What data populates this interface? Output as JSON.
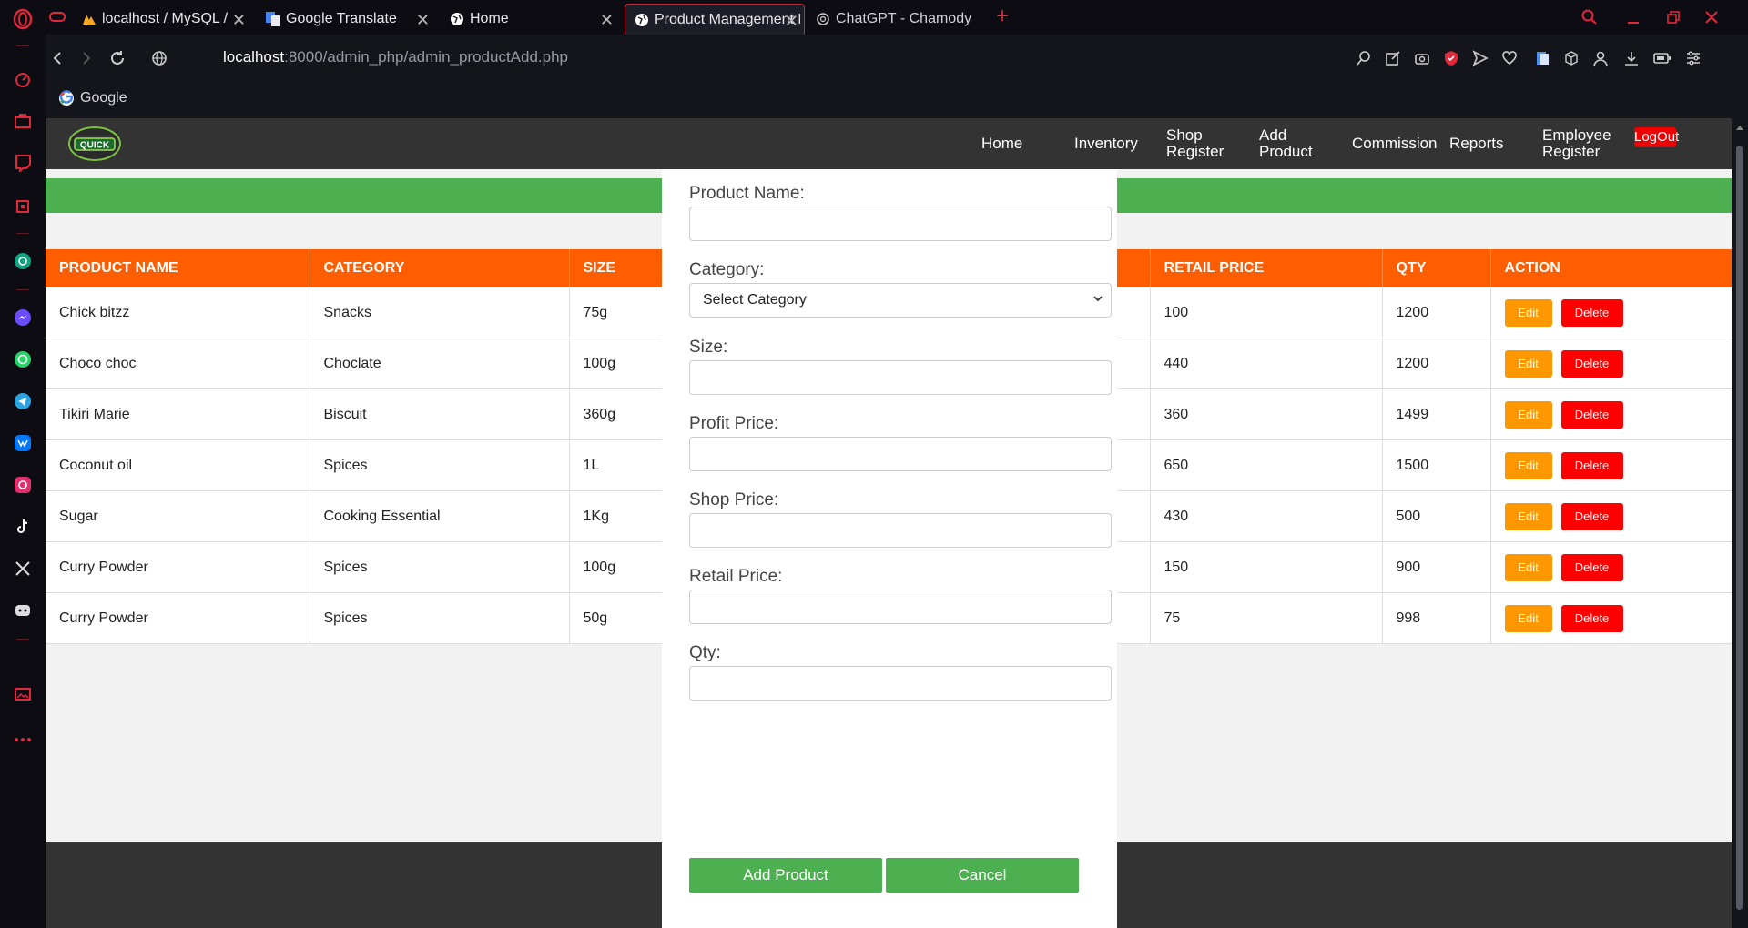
{
  "browser": {
    "tabs": [
      {
        "title": "localhost / MySQL / quickm",
        "icon": "phpmyadmin-icon"
      },
      {
        "title": "Google Translate",
        "icon": "translate-icon"
      },
      {
        "title": "Home",
        "icon": "globe-icon"
      },
      {
        "title": "Product Management Page",
        "icon": "globe-icon"
      },
      {
        "title": "ChatGPT - Chamodya's GPT",
        "icon": "chatgpt-icon"
      }
    ],
    "url_host": "localhost",
    "url_path": ":8000/admin_php/admin_productAdd.php",
    "bookmark": "Google"
  },
  "site": {
    "logo_text": "QUICK",
    "nav": {
      "home": "Home",
      "inventory": "Inventory",
      "shop_register_1": "Shop",
      "shop_register_2": "Register",
      "add_product_1": "Add",
      "add_product_2": "Product",
      "commission": "Commission",
      "reports": "Reports",
      "employee_register_1": "Employee",
      "employee_register_2": "Register",
      "logout": "LogOut"
    },
    "colors": {
      "header": "#333333",
      "banner": "#4caf50",
      "table_header": "#ff5e00",
      "edit": "#ff9800",
      "delete": "#ff0000",
      "logout": "#ee0000"
    }
  },
  "table": {
    "headers": {
      "name": "PRODUCT NAME",
      "category": "CATEGORY",
      "size": "SIZE",
      "retail": "RETAIL PRICE",
      "qty": "QTY",
      "action": "ACTION"
    },
    "edit_label": "Edit",
    "delete_label": "Delete",
    "rows": [
      {
        "name": "Chick bitzz",
        "category": "Snacks",
        "size": "75g",
        "retail": "100",
        "qty": "1200"
      },
      {
        "name": "Choco choc",
        "category": "Choclate",
        "size": "100g",
        "retail": "440",
        "qty": "1200"
      },
      {
        "name": "Tikiri Marie",
        "category": "Biscuit",
        "size": "360g",
        "retail": "360",
        "qty": "1499"
      },
      {
        "name": "Coconut oil",
        "category": "Spices",
        "size": "1L",
        "retail": "650",
        "qty": "1500"
      },
      {
        "name": "Sugar",
        "category": "Cooking Essential",
        "size": "1Kg",
        "retail": "430",
        "qty": "500"
      },
      {
        "name": "Curry Powder",
        "category": "Spices",
        "size": "100g",
        "retail": "150",
        "qty": "900"
      },
      {
        "name": "Curry Powder",
        "category": "Spices",
        "size": "50g",
        "retail": "75",
        "qty": "998"
      }
    ]
  },
  "form": {
    "product_name_label": "Product Name:",
    "category_label": "Category:",
    "category_selected": "Select Category",
    "size_label": "Size:",
    "profit_price_label": "Profit Price:",
    "shop_price_label": "Shop Price:",
    "retail_price_label": "Retail Price:",
    "qty_label": "Qty:",
    "add_button": "Add Product",
    "cancel_button": "Cancel"
  }
}
